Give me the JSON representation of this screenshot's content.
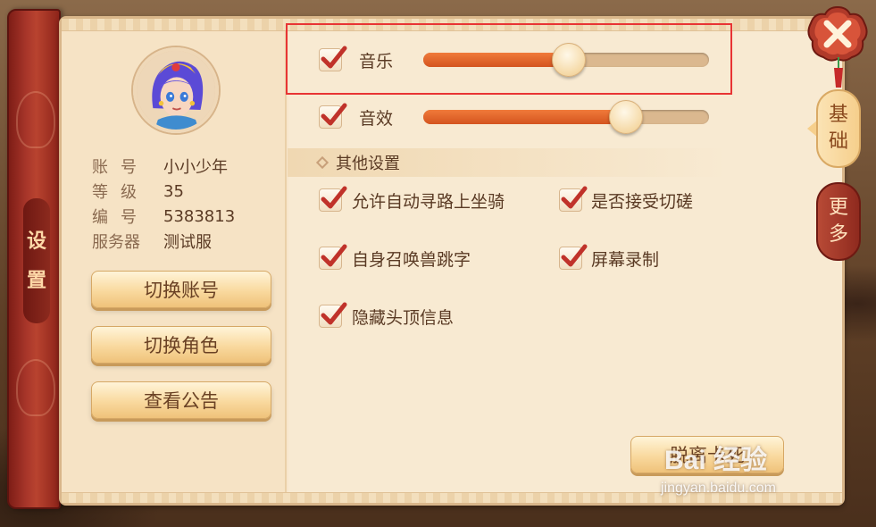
{
  "sidebar": {
    "title_chars": [
      "设",
      "置"
    ]
  },
  "profile": {
    "rows": [
      {
        "key": "账号",
        "value": "小小少年"
      },
      {
        "key": "等级",
        "value": "35"
      },
      {
        "key": "编号",
        "value": "5383813"
      },
      {
        "key": "服务器",
        "value": "测试服"
      }
    ]
  },
  "actions": {
    "switch_account": "切换账号",
    "switch_role": "切换角色",
    "view_notice": "查看公告"
  },
  "audio": {
    "music": {
      "label": "音乐",
      "checked": true,
      "level": 0.51
    },
    "sfx": {
      "label": "音效",
      "checked": true,
      "level": 0.71
    }
  },
  "other": {
    "title": "其他设置",
    "options": [
      {
        "label": "允许自动寻路上坐骑",
        "checked": true
      },
      {
        "label": "是否接受切磋",
        "checked": true
      },
      {
        "label": "自身召唤兽跳字",
        "checked": true
      },
      {
        "label": "屏幕录制",
        "checked": true
      },
      {
        "label": "隐藏头顶信息",
        "checked": true
      }
    ]
  },
  "unstuck_button": "脱离卡死",
  "tabs": {
    "basic": [
      "基",
      "础"
    ],
    "more": [
      "更",
      "多"
    ]
  },
  "colors": {
    "accent_red": "#a8362a",
    "parchment": "#f7e6cc",
    "slider_fill": "#e0642a",
    "highlight": "#e83434"
  },
  "watermark": {
    "logo": "Bai 经验",
    "url": "jingyan.baidu.com"
  }
}
